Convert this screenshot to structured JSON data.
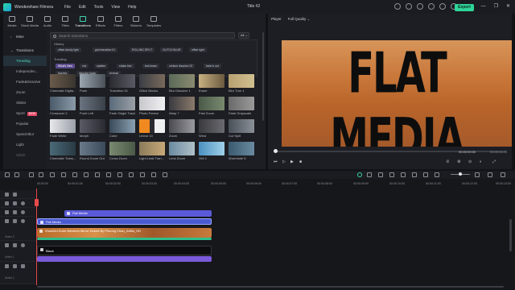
{
  "app": {
    "name": "Wondershare Filmora",
    "menu": [
      "File",
      "Edit",
      "Tools",
      "View",
      "Help"
    ],
    "project_title": "Title #2",
    "export_label": "Export",
    "window_controls": [
      "—",
      "❐",
      "✕"
    ]
  },
  "media_tabs": [
    "Media",
    "Stock Media",
    "Audio",
    "Titles",
    "Transitions",
    "Effects",
    "Filters",
    "Stickers",
    "Templates"
  ],
  "sidebar": {
    "mine": "Mine",
    "transitions": "Transitions",
    "items": [
      "Trending",
      "Independen...",
      "Fade&Dissolve",
      "Zoom",
      "Slides",
      "Sport",
      "Popular",
      "Speed Blur",
      "Light",
      "Glitch"
    ],
    "new_badge": "NEW"
  },
  "search": {
    "placeholder": "Search transitions",
    "filter": "All"
  },
  "history": {
    "label": "History",
    "chips": [
      "offset dizzily light",
      "grid transition 01",
      "ROLLING SPLIT",
      "GLITCH BLUR",
      "offset right"
    ]
  },
  "trending": {
    "label": "Trending",
    "chips": [
      "What's New",
      "mix",
      "splatter",
      "shake blur",
      "text beam",
      "venture dissolve 02",
      "fade in out",
      "blurring",
      "dissolve black",
      "reverse"
    ]
  },
  "grid": [
    [
      "Cinematic Digita...",
      "Push",
      "Transition 01",
      "Glitch Blocks",
      "Blur Dissolve 1",
      "Erase",
      "Blur Turn 1"
    ],
    [
      "Crossover 2",
      "Push Left",
      "Fade Single Track",
      "Photo Freeze",
      "Warp 7",
      "Fast Zoom",
      "Fade Grayscale"
    ],
    [
      "Fade White",
      "Morph",
      "Cube",
      "Linear 14",
      "Zoom",
      "Wind",
      "Cut Split"
    ],
    [
      "Cinematic Trans...",
      "Round Zoom Out",
      "Cross Zoom",
      "Light Leak Tran...",
      "Lens Zoom",
      "Orb 1",
      "Wormhole 5"
    ]
  ],
  "player": {
    "tab": "Player",
    "quality": "Full Quality",
    "video_text": "FLAT MEDIA",
    "time_current": "00:00:00:00",
    "time_total": "00:00:04:21"
  },
  "timeline": {
    "ruler": [
      "00:00:00",
      "00:00:01:00",
      "00:00:02:00",
      "00:00:03:00",
      "00:00:04:00",
      "00:00:05:00",
      "00:00:06:00",
      "00:00:07:00",
      "00:00:08:00",
      "00:00:09:00",
      "00:00:10:00",
      "00:00:11:00",
      "00:00:12:00",
      "00:00:13:00"
    ],
    "track_labels": [
      "Video 2",
      "Video 1",
      "Audio 1"
    ],
    "clips": {
      "title_clip": "Flat Media",
      "title_clip2": "Flat Media",
      "video_clip": "93ad44d Dune Between Mirror Desert By Phuong Chau_Artlist_HD",
      "black_clip": "Black"
    }
  },
  "colors": {
    "accent": "#2fd59a",
    "clip_purple": "#5a5ad8",
    "clip_orange": "#c87a3c",
    "playhead": "#e64a4a"
  }
}
